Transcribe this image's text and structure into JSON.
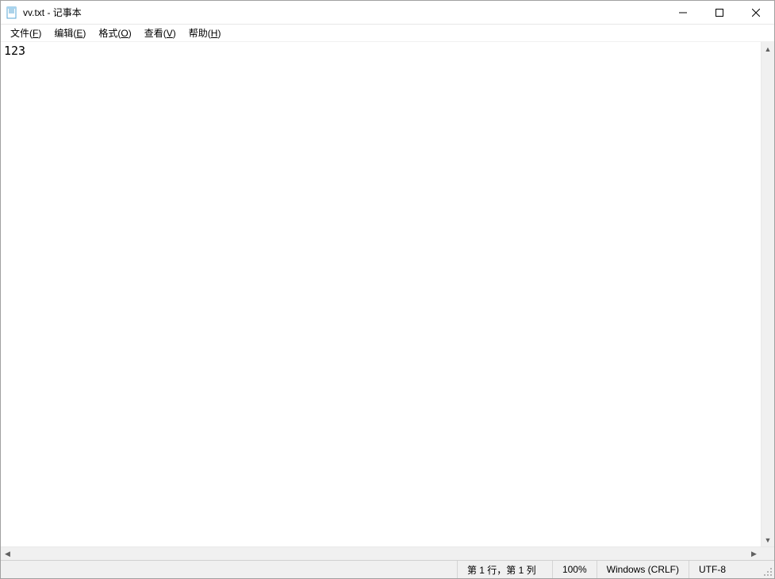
{
  "titlebar": {
    "title": "vv.txt - 记事本",
    "icon": "notepad-icon"
  },
  "menubar": {
    "items": [
      {
        "label": "文件",
        "accel": "F"
      },
      {
        "label": "编辑",
        "accel": "E"
      },
      {
        "label": "格式",
        "accel": "O"
      },
      {
        "label": "查看",
        "accel": "V"
      },
      {
        "label": "帮助",
        "accel": "H"
      }
    ]
  },
  "editor": {
    "content": "123"
  },
  "statusbar": {
    "position": "第 1 行，第 1 列",
    "zoom": "100%",
    "line_ending": "Windows (CRLF)",
    "encoding": "UTF-8"
  }
}
